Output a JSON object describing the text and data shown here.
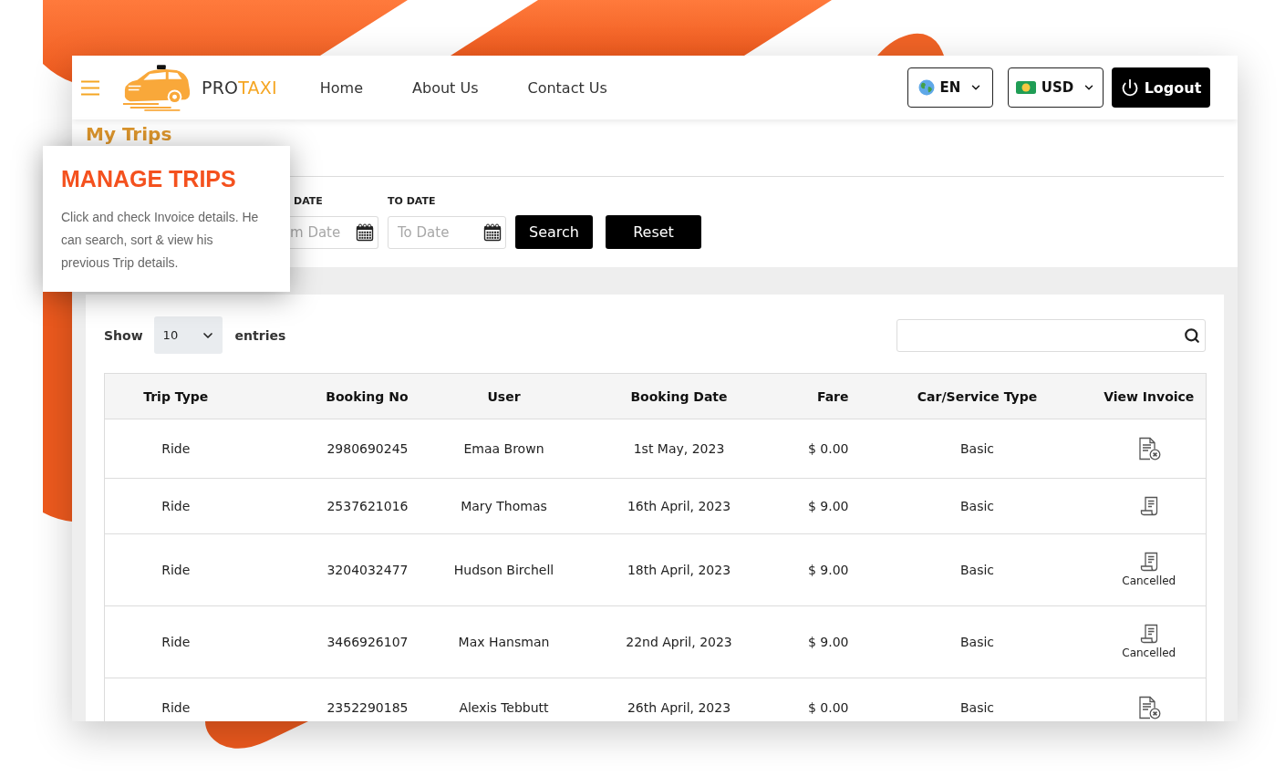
{
  "header": {
    "logo": {
      "parts": [
        {
          "text": "PRO",
          "color": "#333333"
        },
        {
          "text": "TAXI",
          "color": "#f5a623"
        }
      ]
    },
    "nav": [
      {
        "label": "Home"
      },
      {
        "label": "About Us"
      },
      {
        "label": "Contact Us"
      }
    ],
    "language": {
      "label": "EN"
    },
    "currency": {
      "label": "USD"
    },
    "logout": {
      "label": "Logout"
    }
  },
  "callout": {
    "title": "MANAGE TRIPS",
    "text": "Click and check Invoice details. He can search, sort & view his previous Trip details."
  },
  "page_title": "My Trips",
  "filters": {
    "from_date": {
      "label": "DATE",
      "placeholder": "m Date"
    },
    "to_date": {
      "label": "TO DATE",
      "placeholder": "To Date"
    },
    "buttons": [
      {
        "label": "Search"
      },
      {
        "label": "Reset"
      }
    ]
  },
  "entries": {
    "show_label": "Show",
    "page_size": "10",
    "entries_label": "entries"
  },
  "table": {
    "columns": [
      "Trip Type",
      "Booking No",
      "User",
      "Booking Date",
      "Fare",
      "Car/Service Type",
      "View Invoice"
    ],
    "rows": [
      {
        "cells": [
          "Ride",
          "2980690245",
          "Emaa Brown",
          "1st May, 2023",
          "$ 0.00",
          "Basic"
        ],
        "invoice": {
          "kind": "crossed"
        }
      },
      {
        "cells": [
          "Ride",
          "2537621016",
          "Mary Thomas",
          "16th April, 2023",
          "$ 9.00",
          "Basic"
        ],
        "invoice": {
          "kind": "receipt"
        }
      },
      {
        "cells": [
          "Ride",
          "3204032477",
          "Hudson Birchell",
          "18th April, 2023",
          "$ 9.00",
          "Basic"
        ],
        "invoice": {
          "kind": "receipt",
          "status": "Cancelled"
        }
      },
      {
        "cells": [
          "Ride",
          "3466926107",
          "Max Hansman",
          "22nd April, 2023",
          "$ 9.00",
          "Basic"
        ],
        "invoice": {
          "kind": "receipt",
          "status": "Cancelled"
        }
      },
      {
        "cells": [
          "Ride",
          "2352290185",
          "Alexis Tebbutt",
          "26th April, 2023",
          "$ 0.00",
          "Basic"
        ],
        "invoice": {
          "kind": "crossed"
        }
      }
    ]
  }
}
